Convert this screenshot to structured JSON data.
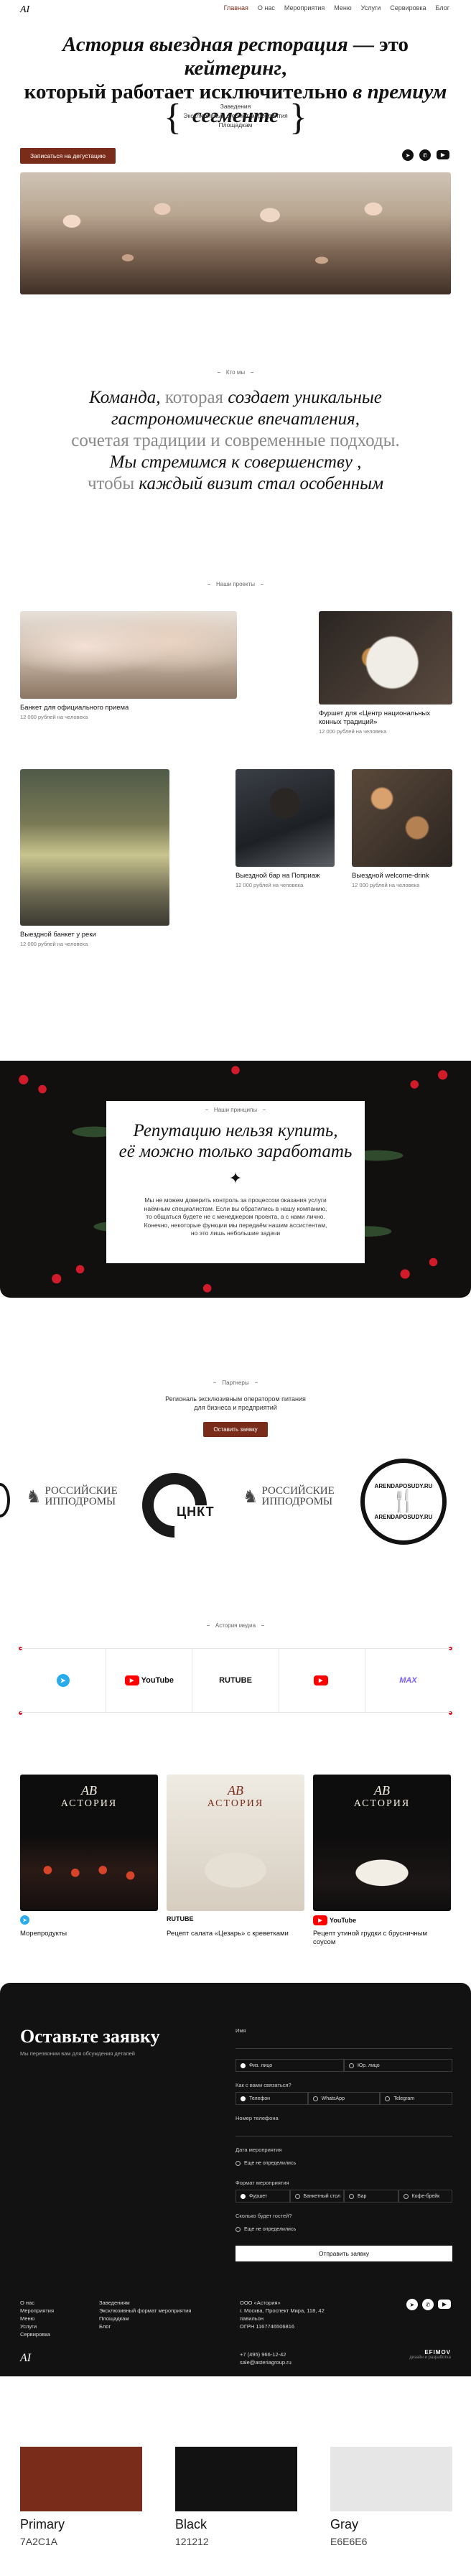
{
  "header": {
    "logo": "AI",
    "nav": [
      "Главная",
      "О нас",
      "Мероприятия",
      "Меню",
      "Услуги",
      "Сервировка",
      "Блог"
    ],
    "title_parts": [
      "Астория выездная ресторация",
      " — это ",
      "кейтеринг",
      ",",
      "который работает исключительно ",
      "в премиум сегменте"
    ],
    "formats": [
      "Заведения",
      "Эксклюзивный формат мероприятия",
      "Площадкам"
    ],
    "cta": "Записаться на дегустацию",
    "social_icons": [
      "telegram-icon",
      "whatsapp-icon",
      "youtube-icon"
    ]
  },
  "about": {
    "label": "Кто мы",
    "lines": [
      [
        {
          "t": "Команда, ",
          "s": "it"
        },
        {
          "t": "которая ",
          "s": "g"
        },
        {
          "t": "создает уникальные",
          "s": "it"
        }
      ],
      [
        {
          "t": "гастрономические впечатления,",
          "s": "it"
        }
      ],
      [
        {
          "t": "сочетая традиции и современные подходы.",
          "s": "g"
        }
      ],
      [
        {
          "t": "Мы стремимся к совершенству ,",
          "s": "it"
        }
      ],
      [
        {
          "t": "чтобы ",
          "s": "g"
        },
        {
          "t": "каждый визит стал особенным",
          "s": "it"
        }
      ]
    ]
  },
  "projects": {
    "label": "Наши проекты",
    "items": [
      {
        "title": "Банкет для официального приема",
        "price": "12 000 рублей на человека"
      },
      {
        "title": "Фуршет для «Центр национальных конных традиций»",
        "price": "12 000 рублей на человека"
      },
      {
        "title": "Выездной банкет у реки",
        "price": "12 000 рублей на человека"
      },
      {
        "title": "Выездной бар на Поприаж",
        "price": "12 000 рублей на человека"
      },
      {
        "title": "Выездной welcome-drink",
        "price": "12 000 рублей на человека"
      }
    ]
  },
  "reputation": {
    "label": "Наши принципы",
    "title_line1": "Репутацию нельзя купить,",
    "title_line2": "её можно только заработать",
    "sparkle": "✦",
    "text": "Мы не можем доверить контроль за процессом оказания услуги наёмным специалистам. Если вы обратились в нашу компанию, то общаться будете не с менеджером проекта, а с нами лично. Конечно, некоторые функции мы передаём нашим ассистентам, но это лишь небольшие задачи"
  },
  "partners": {
    "label": "Партнеры",
    "intro_line1": "Региональ эксклюзивным оператором питания",
    "intro_line2": "для бизнеса и предприятий",
    "button": "Оставить заявку",
    "logos": [
      {
        "line1": "РОССИЙСКИЕ",
        "line2": "ИППОДРОМЫ"
      },
      {
        "text": "ЦНКТ"
      },
      {
        "line1": "РОССИЙСКИЕ",
        "line2": "ИППОДРОМЫ"
      },
      {
        "top": "ARENDAPOSUDY.RU",
        "bottom": "ARENDAPOSUDY.RU"
      }
    ]
  },
  "media": {
    "label": "Астория медиа",
    "platforms": [
      "Telegram",
      "YouTube",
      "RUTUBE",
      "YouTube",
      "МАХ"
    ],
    "videos": [
      {
        "caption": "Морепродукты",
        "source": "Telegram",
        "brand_mono": "AB",
        "brand_name": "АСТОРИЯ"
      },
      {
        "caption": "Рецепт салата «Цезарь» с креветками",
        "source": "RUTUBE",
        "brand_mono": "AB",
        "brand_name": "АСТОРИЯ"
      },
      {
        "caption": "Рецепт утиной грудки с брусничным соусом",
        "source": "YouTube",
        "brand_mono": "AB",
        "brand_name": "АСТОРИЯ"
      }
    ]
  },
  "form": {
    "title": "Оставьте заявку",
    "note": "Мы перезвоним вам для обсуждения деталей",
    "name_label": "Имя",
    "face_options": [
      "Физ. лицо",
      "Юр. лицо"
    ],
    "contact_label": "Как с вами связаться?",
    "contact_options": [
      "Телефон",
      "WhatsApp",
      "Telegram"
    ],
    "phone_label": "Номер телефона",
    "date_label": "Дата мероприятия",
    "date_unknown": "Еще не определились",
    "format_label": "Формат мероприятия",
    "format_options": [
      "Фуршет",
      "Банкетный стол",
      "Бар",
      "Кофе-брейк"
    ],
    "guests_label": "Сколько будет гостей?",
    "guests_unknown": "Еще не определились",
    "submit": "Отправить заявку"
  },
  "footer": {
    "col1": [
      "О нас",
      "Мероприятия",
      "Меню",
      "Услуги",
      "Сервировка"
    ],
    "col2": [
      "Заведениям",
      "Эксклюзивный формат мероприятия",
      "Площадкам",
      "Блог"
    ],
    "company": [
      "ООО «Астория»",
      "г. Москва, Проспект Мира, 118, 42 павильон",
      "ОГРН 1167746506816"
    ],
    "phone": "+7 (495) 966-12-42",
    "email": "sale@asteriagroup.ru",
    "logo": "AI",
    "dev_name": "EFIMOV",
    "dev_note": "дизайн и разработка"
  },
  "palette": [
    {
      "name": "Primary",
      "hex": "7A2C1A",
      "color": "#7A2C1A"
    },
    {
      "name": "Black",
      "hex": "121212",
      "color": "#121212"
    },
    {
      "name": "Gray",
      "hex": "E6E6E6",
      "color": "#E6E6E6"
    }
  ]
}
